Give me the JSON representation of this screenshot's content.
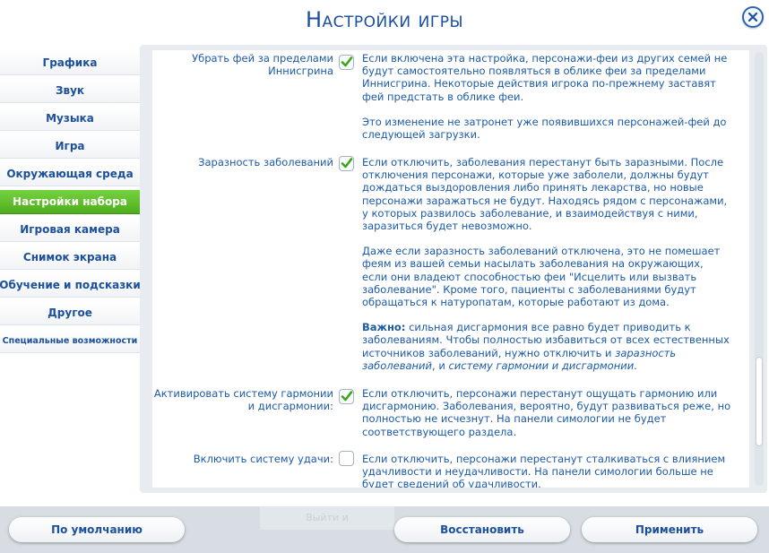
{
  "window": {
    "title": "Настройки игры"
  },
  "sidebar": {
    "items": [
      {
        "label": "Графика"
      },
      {
        "label": "Звук"
      },
      {
        "label": "Музыка"
      },
      {
        "label": "Игра"
      },
      {
        "label": "Окружающая среда"
      },
      {
        "label": "Настройки набора",
        "active": true
      },
      {
        "label": "Игровая камера"
      },
      {
        "label": "Снимок экрана"
      },
      {
        "label": "Обучение и подсказки"
      },
      {
        "label": "Другое"
      },
      {
        "label": "Специальные возможности"
      }
    ]
  },
  "settings": [
    {
      "label": "Убрать фей за пределами Иннисгрина",
      "checked": true,
      "paragraphs": [
        "Если включена эта настройка, персонажи-феи из других семей не будут самостоятельно появляться в облике феи за пределами Иннисгрина. Некоторые действия игрока по-прежнему заставят фей предстать в облике феи.",
        "Это изменение не затронет уже появившихся персонажей-фей до следующей загрузки."
      ]
    },
    {
      "label": "Заразность заболеваний",
      "checked": true,
      "paragraphs": [
        "Если отключить, заболевания перестанут быть заразными. После отключения персонажи, которые уже заболели, должны будут дождаться выздоровления либо принять лекарства, но новые персонажи заражаться не будут. Находясь рядом с персонажами, у которых развилось заболевание, и взаимодействуя с ними, заразиться будет невозможно.",
        "Даже если заразность заболеваний отключена, это не помешает феям из вашей семьи насылать заболевания на окружающих, если они владеют способностью феи \"Исцелить или вызвать заболевание\". Кроме того, пациенты с заболеваниями будут обращаться к натуропатам, которые работают из дома."
      ],
      "important": {
        "bold": "Важно:",
        "text": " сильная дисгармония все равно будет приводить к заболеваниям. Чтобы полностью избавиться от всех естественных источников заболеваний, нужно отключить и ",
        "italic1": "заразность заболеваний",
        "mid": ", и ",
        "italic2": "систему гармонии и дисгармонии",
        "end": "."
      }
    },
    {
      "label": "Активировать систему гармонии и дисгармонии:",
      "checked": true,
      "paragraphs": [
        "Если отключить, персонажи перестанут ощущать гармонию или дисгармонию. Заболевания, вероятно, будут развиваться реже, но полностью не исчезнут. На панели симологии не будет соответствующего раздела."
      ]
    },
    {
      "label": "Включить систему удачи:",
      "checked": false,
      "paragraphs": [
        "Если отключить, персонажи перестанут сталкиваться с влиянием удачливости и неудачливости. На панели симологии больше не будет сведений об удачливости."
      ]
    }
  ],
  "buttons": {
    "default": "По умолчанию",
    "restore": "Восстановить",
    "apply": "Применить",
    "hidden_exit": "Выйти и"
  },
  "icons": {
    "close": "close-icon",
    "check": "checkmark-icon"
  },
  "colors": {
    "accent_green": "#5bbf24",
    "text_blue": "#1c5aa8"
  }
}
